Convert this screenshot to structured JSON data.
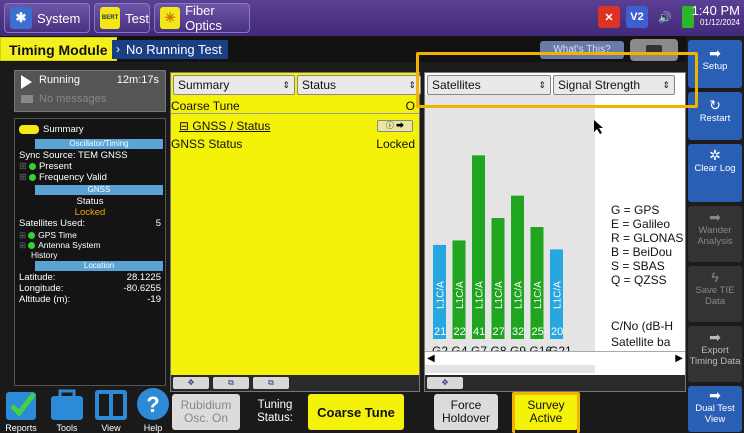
{
  "topbar": {
    "system_label": "System",
    "test_label": "Test",
    "test_icon_text": "BERT",
    "fiber_label": "Fiber Optics",
    "icons": [
      "close-x-icon",
      "v2-icon",
      "speaker-icon",
      "battery-icon"
    ],
    "v2_text": "V2",
    "time": "1:40 PM",
    "date": "01/12/2024"
  },
  "title": {
    "module": "Timing Module",
    "state": "No Running Test",
    "whats_this": "What's This?"
  },
  "left": {
    "run_label": "Running",
    "run_time": "12m:17s",
    "messages": "No messages",
    "summary_label": "Summary",
    "sec_osc": "Oscillator/Timing",
    "sync_source": "Sync Source: TEM GNSS",
    "present": "Present",
    "freq_valid": "Frequency Valid",
    "sec_gnss": "GNSS",
    "status_label": "Status",
    "status_value": "Locked",
    "sat_used_label": "Satellites Used:",
    "sat_used_value": "5",
    "gps_time": "GPS Time",
    "antenna": "Antenna System",
    "history": "History",
    "sec_location": "Location",
    "lat_label": "Latitude:",
    "lat_value": "28.1225",
    "lon_label": "Longitude:",
    "lon_value": "-80.6255",
    "alt_label": "Altitude (m):",
    "alt_value": "-19"
  },
  "bottom_left": {
    "reports": "Reports",
    "tools": "Tools",
    "view": "View",
    "help": "Help"
  },
  "summary_panel": {
    "select1": "Summary",
    "select2": "Status",
    "coarse_tune": "Coarse Tune",
    "coarse_val": "O",
    "gnss_status_link": "GNSS / Status",
    "gnss_status": "GNSS Status",
    "gnss_status_val": "Locked"
  },
  "sat_panel": {
    "select1": "Satellites",
    "select2": "Signal Strength",
    "legend": [
      "G = GPS",
      "E = Galileo",
      "R = GLONAS",
      "B = BeiDou",
      "S = SBAS",
      "Q = QZSS"
    ],
    "cno_label": "C/No (dB-H",
    "sat_bar_label": "Satellite ba"
  },
  "chart_data": {
    "type": "bar",
    "categories": [
      "G2",
      "G4",
      "G7",
      "G8",
      "G9",
      "G16",
      "G21"
    ],
    "values": [
      21,
      22,
      41,
      27,
      32,
      25,
      20
    ],
    "band_labels": [
      "L1C/A",
      "L1C/A",
      "L1C/A",
      "L1C/A",
      "L1C/A",
      "L1C/A",
      "L1C/A"
    ],
    "colors": [
      "#27a7e0",
      "#1fa51f",
      "#1fa51f",
      "#1fa51f",
      "#1fa51f",
      "#1fa51f",
      "#27a7e0"
    ],
    "ylim": [
      0,
      50
    ]
  },
  "bottom_controls": {
    "rubidium": "Rubidium Osc. On",
    "tuning_status_label": "Tuning Status:",
    "tuning_status_value": "Coarse Tune",
    "force_holdover": "Force Holdover",
    "survey_active": "Survey Active"
  },
  "sidebar": {
    "setup": "Setup",
    "restart": "Restart",
    "clear_log": "Clear Log",
    "wander_analysis": "Wander Analysis",
    "save_tie": "Save TIE Data",
    "export_timing": "Export Timing Data",
    "dual_test": "Dual Test View"
  },
  "colors": {
    "accent_purple": "#4a3282",
    "panel_yellow": "#f5f20a",
    "highlight_orange": "#f1b200"
  }
}
